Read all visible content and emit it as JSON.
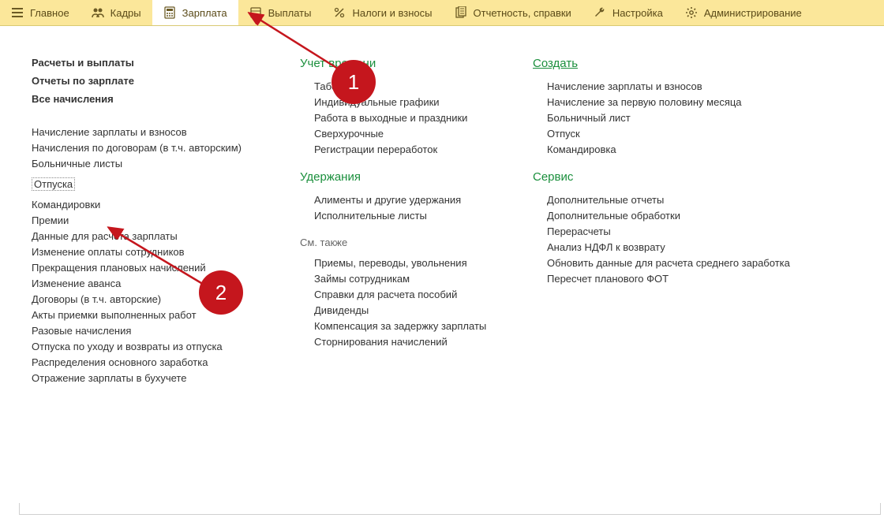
{
  "topbar": {
    "items": [
      {
        "label": "Главное",
        "icon": "menu"
      },
      {
        "label": "Кадры",
        "icon": "people"
      },
      {
        "label": "Зарплата",
        "icon": "calc",
        "active": true
      },
      {
        "label": "Выплаты",
        "icon": "wallet"
      },
      {
        "label": "Налоги и взносы",
        "icon": "percent"
      },
      {
        "label": "Отчетность, справки",
        "icon": "report"
      },
      {
        "label": "Настройка",
        "icon": "wrench"
      },
      {
        "label": "Администрирование",
        "icon": "gear"
      }
    ]
  },
  "col1": {
    "bold": [
      "Расчеты и выплаты",
      "Отчеты по зарплате",
      "Все начисления"
    ],
    "items": [
      "Начисление зарплаты и взносов",
      "Начисления по договорам (в т.ч. авторским)",
      "Больничные листы",
      "Отпуска",
      "Командировки",
      "Премии",
      "Данные для расчета зарплаты",
      "Изменение оплаты сотрудников",
      "Прекращения плановых начислений",
      "Изменение аванса",
      "Договоры (в т.ч. авторские)",
      "Акты приемки выполненных работ",
      "Разовые начисления",
      "Отпуска по уходу и возвраты из отпуска",
      "Распределения основного заработка",
      "Отражение зарплаты в бухучете"
    ],
    "selected_index": 3
  },
  "col2": {
    "sec1_title": "Учет времени",
    "sec1_items": [
      "Табели",
      "Индивидуальные графики",
      "Работа в выходные и праздники",
      "Сверхурочные",
      "Регистрации переработок"
    ],
    "sec2_title": "Удержания",
    "sec2_items": [
      "Алименты и другие удержания",
      "Исполнительные листы"
    ],
    "sec3_title": "См. также",
    "sec3_items": [
      "Приемы, переводы, увольнения",
      "Займы сотрудникам",
      "Справки для расчета пособий",
      "Дивиденды",
      "Компенсация за задержку зарплаты",
      "Сторнирования начислений"
    ]
  },
  "col3": {
    "sec1_title": "Создать",
    "sec1_items": [
      "Начисление зарплаты и взносов",
      "Начисление за первую половину месяца",
      "Больничный лист",
      "Отпуск",
      "Командировка"
    ],
    "sec2_title": "Сервис",
    "sec2_items": [
      "Дополнительные отчеты",
      "Дополнительные обработки",
      "Перерасчеты",
      "Анализ НДФЛ к возврату",
      "Обновить данные для расчета среднего заработка",
      "Пересчет планового ФОТ"
    ]
  },
  "badges": {
    "one": "1",
    "two": "2"
  }
}
